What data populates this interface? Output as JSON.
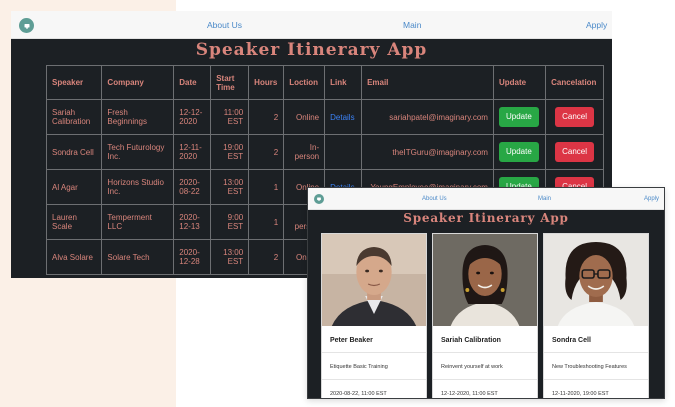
{
  "colors": {
    "accent_title": "#d9857c",
    "link": "#4a89c8",
    "update": "#28a745",
    "cancel": "#dc3545",
    "dark_bg": "#1c2024"
  },
  "nav": {
    "logo_icon": "circular-logo-icon",
    "about": "About Us",
    "main": "Main",
    "apply": "Apply"
  },
  "app": {
    "title": "Speaker Itinerary App"
  },
  "table": {
    "headers": [
      "Speaker",
      "Company",
      "Date",
      "Start Time",
      "Hours",
      "Loction",
      "Link",
      "Email",
      "Update",
      "Cancelation"
    ],
    "rows": [
      {
        "speaker": "Sariah Calibration",
        "company": "Fresh Beginnings",
        "date": "12-12-2020",
        "start": "11:00 EST",
        "hours": "2",
        "location": "Online",
        "link": "Details",
        "email": "sariahpatel@imaginary.com",
        "update": "Update",
        "cancel": "Cancel"
      },
      {
        "speaker": "Sondra Cell",
        "company": "Tech Futurology Inc.",
        "date": "12-11-2020",
        "start": "19:00 EST",
        "hours": "2",
        "location": "In-person",
        "link": "",
        "email": "theITGuru@imaginary.com",
        "update": "Update",
        "cancel": "Cancel"
      },
      {
        "speaker": "Al Agar",
        "company": "Horizons Studio Inc.",
        "date": "2020-08-22",
        "start": "13:00 EST",
        "hours": "1",
        "location": "Online",
        "link": "Details",
        "email": "YoungEmployee@imaginary.com",
        "update": "Update",
        "cancel": "Cancel"
      },
      {
        "speaker": "Lauren Scale",
        "company": "Temperment LLC",
        "date": "2020-12-13",
        "start": "9:00 EST",
        "hours": "1",
        "location": "In-person",
        "link": "",
        "email": "",
        "update": "",
        "cancel": ""
      },
      {
        "speaker": "Alva Solare",
        "company": "Solare Tech",
        "date": "2020-12-28",
        "start": "13:00 EST",
        "hours": "2",
        "location": "Online",
        "link": "",
        "email": "",
        "update": "",
        "cancel": ""
      }
    ]
  },
  "cards": [
    {
      "name": "Peter Beaker",
      "topic": "Etiquette Basic Training",
      "datetime": "2020-08-22, 11:00 EST"
    },
    {
      "name": "Sariah Calibration",
      "topic": "Reinvent yourself at work",
      "datetime": "12-12-2020, 11:00 EST"
    },
    {
      "name": "Sondra Cell",
      "topic": "New Troubleshooting Features",
      "datetime": "12-11-2020, 19:00 EST"
    }
  ]
}
